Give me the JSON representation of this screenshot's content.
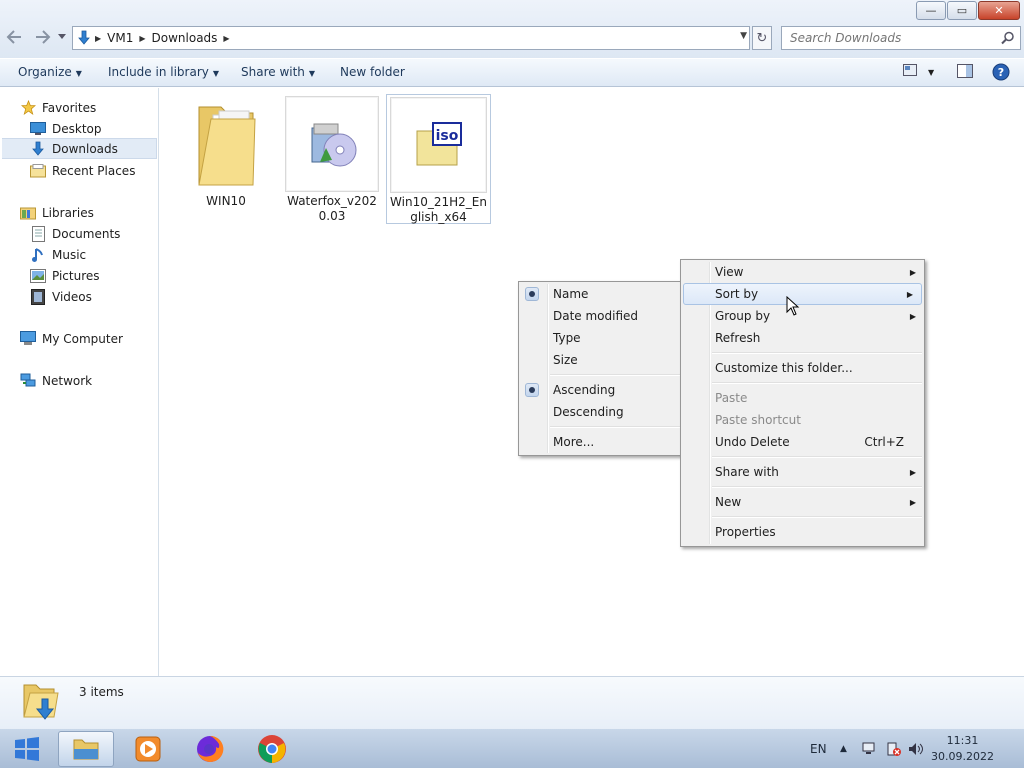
{
  "window": {
    "controls": {
      "minimize": "—",
      "maximize": "▭",
      "close": "✕"
    }
  },
  "address": {
    "back_icon": "arrow-left-icon",
    "forward_icon": "arrow-right-icon",
    "breadcrumbs": [
      "VM1",
      "Downloads"
    ],
    "search_placeholder": "Search Downloads"
  },
  "toolbar": {
    "organize": "Organize",
    "include_in_library": "Include in library",
    "share_with": "Share with",
    "new_folder": "New folder"
  },
  "nav": {
    "favorites": "Favorites",
    "desktop": "Desktop",
    "downloads": "Downloads",
    "recent_places": "Recent Places",
    "libraries": "Libraries",
    "documents": "Documents",
    "music": "Music",
    "pictures": "Pictures",
    "videos": "Videos",
    "my_computer": "My Computer",
    "network": "Network"
  },
  "files": [
    {
      "name": "WIN10",
      "type": "folder"
    },
    {
      "name": "Waterfox_v2020.03",
      "type": "installer"
    },
    {
      "name": "Win10_21H2_English_x64",
      "type": "iso"
    }
  ],
  "details": {
    "count": "3 items"
  },
  "context_menu": {
    "view": "View",
    "sort_by": "Sort by",
    "group_by": "Group by",
    "refresh": "Refresh",
    "customize": "Customize this folder...",
    "paste": "Paste",
    "paste_shortcut": "Paste shortcut",
    "undo_delete": "Undo Delete",
    "undo_shortcut": "Ctrl+Z",
    "share_with": "Share with",
    "new": "New",
    "properties": "Properties"
  },
  "sort_menu": {
    "name": "Name",
    "date_modified": "Date modified",
    "type": "Type",
    "size": "Size",
    "ascending": "Ascending",
    "descending": "Descending",
    "more": "More...",
    "selected_field": "Name",
    "selected_order": "Ascending"
  },
  "taskbar": {
    "language": "EN",
    "time": "11:31",
    "date": "30.09.2022"
  },
  "colors": {
    "accent": "#1e395b",
    "selection": "#e2ebf6",
    "menu_bg": "#f0f0f0"
  }
}
